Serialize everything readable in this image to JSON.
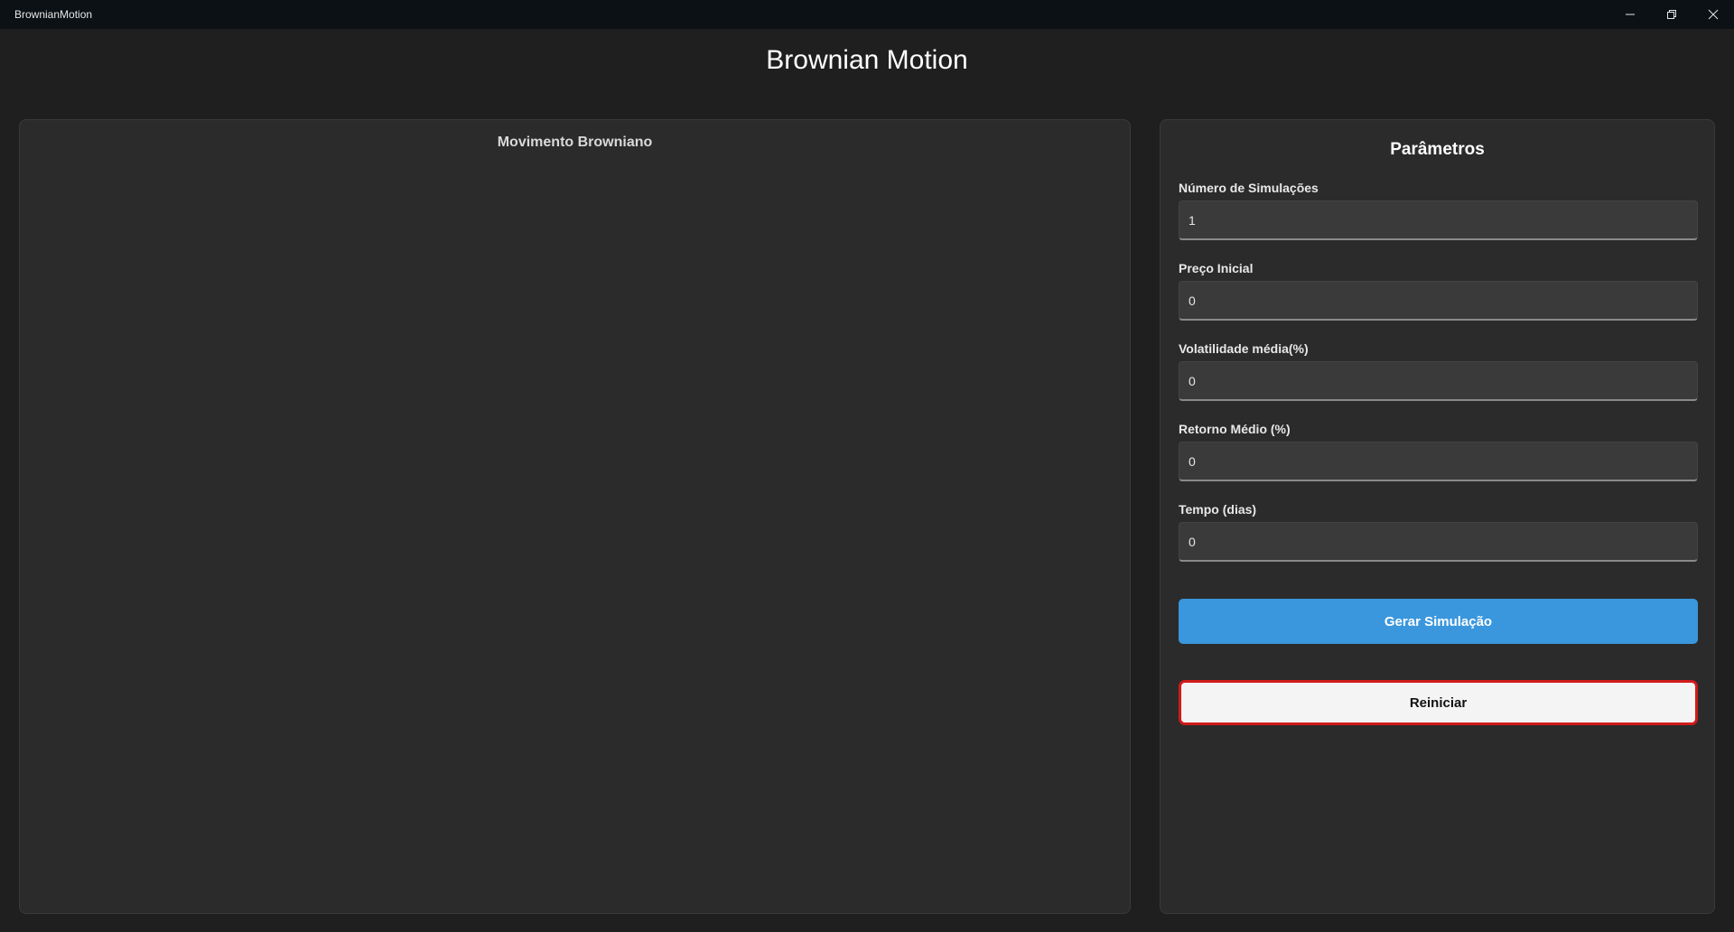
{
  "window": {
    "title": "BrownianMotion",
    "controls": [
      "minimize-icon",
      "restore-icon",
      "close-icon"
    ]
  },
  "header": {
    "title": "Brownian Motion"
  },
  "chart_panel": {
    "title": "Movimento Browniano"
  },
  "params_panel": {
    "title": "Parâmetros",
    "fields": [
      {
        "label": "Número de Simulações",
        "value": "1"
      },
      {
        "label": "Preço Inicial",
        "value": "0"
      },
      {
        "label": "Volatilidade média(%)",
        "value": "0"
      },
      {
        "label": "Retorno Médio (%)",
        "value": "0"
      },
      {
        "label": "Tempo (dias)",
        "value": "0"
      }
    ],
    "generate_label": "Gerar Simulação",
    "reset_label": "Reiniciar"
  },
  "colors": {
    "background": "#1f1f1f",
    "titlebar": "#0b1115",
    "panel": "#2b2b2b",
    "primary_button": "#3a97dd",
    "reset_border": "#d21a1a"
  }
}
